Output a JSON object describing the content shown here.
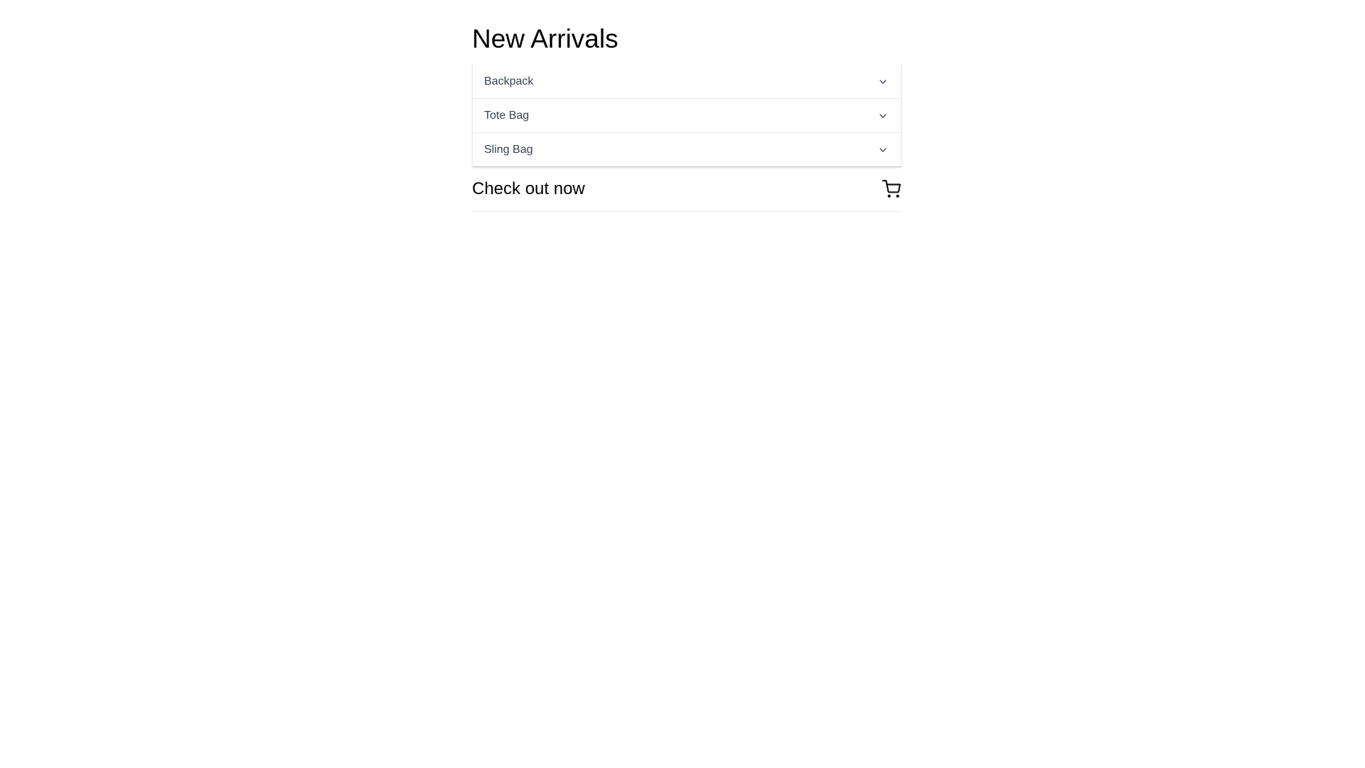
{
  "header": {
    "title": "New Arrivals"
  },
  "accordion": {
    "items": [
      {
        "label": "Backpack",
        "icon": "chevron-down-icon"
      },
      {
        "label": "Tote Bag",
        "icon": "chevron-down-icon"
      },
      {
        "label": "Sling Bag",
        "icon": "chevron-down-icon"
      }
    ]
  },
  "checkout": {
    "label": "Check out now",
    "icon": "shopping-cart-icon"
  },
  "colors": {
    "text_primary": "#000000",
    "text_secondary": "#374151",
    "border": "#e5e7eb",
    "icon": "#4b5563"
  }
}
